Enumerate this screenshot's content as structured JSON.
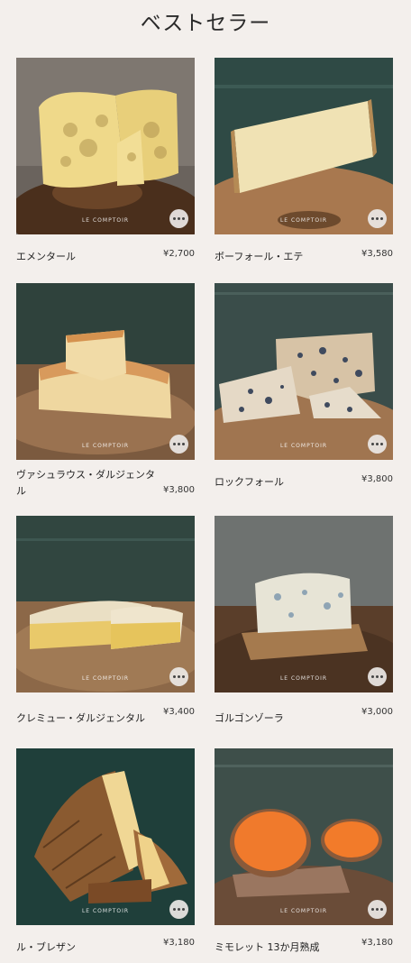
{
  "page": {
    "title": "ベストセラー"
  },
  "products": [
    {
      "name": "エメンタール",
      "price": "¥2,700",
      "logo": "LE COMPTOIR"
    },
    {
      "name": "ボーフォール・エテ",
      "price": "¥3,580",
      "logo": "LE COMPTOIR"
    },
    {
      "name": "ヴァシュラウス・ダルジェンタル",
      "price": "¥3,800",
      "logo": "LE COMPTOIR"
    },
    {
      "name": "ロックフォール",
      "price": "¥3,800",
      "logo": "LE COMPTOIR"
    },
    {
      "name": "クレミュー・ダルジェンタル",
      "price": "¥3,400",
      "logo": "LE COMPTOIR"
    },
    {
      "name": "ゴルゴンゾーラ",
      "price": "¥3,000",
      "logo": "LE COMPTOIR"
    },
    {
      "name": "ル・ブレザン",
      "price": "¥3,180",
      "logo": "LE COMPTOIR"
    },
    {
      "name": "ミモレット 13か月熟成",
      "price": "¥3,180",
      "logo": "LE COMPTOIR"
    }
  ],
  "icons": {
    "more": "more-horizontal-icon"
  }
}
